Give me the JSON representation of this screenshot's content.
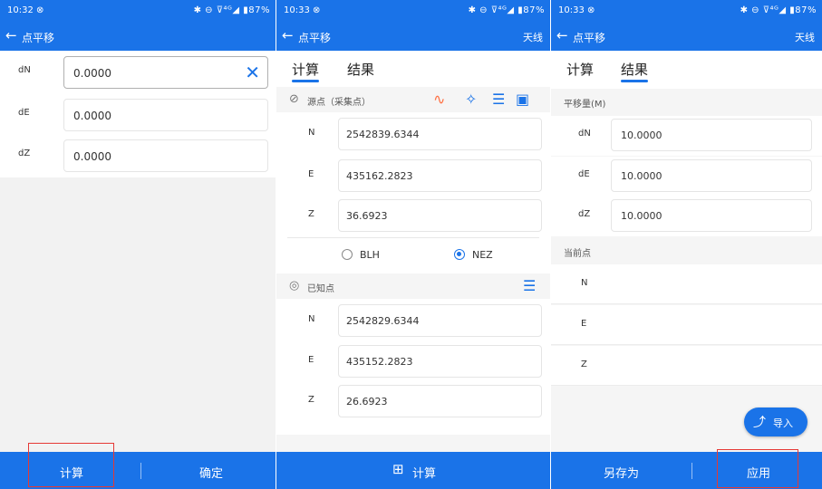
{
  "colors": {
    "primary": "#1a73e8",
    "highlight": "#e53935"
  },
  "panels": [
    {
      "status": {
        "time": "10:32 ⊗",
        "icons": "✱ ⊖ ⊽⁴ᴳ◢ ▮87%"
      },
      "title": "点平移",
      "back_icon": "arrow-left-icon",
      "rows": [
        {
          "label": "dN",
          "value": "0.0000"
        },
        {
          "label": "dE",
          "value": "0.0000"
        },
        {
          "label": "dZ",
          "value": "0.0000"
        }
      ],
      "buttons": {
        "calculate": "计算",
        "confirm": "确定"
      }
    },
    {
      "status": {
        "time": "10:33 ⊗",
        "icons": "✱ ⊖ ⊽⁴ᴳ◢ ▮87%"
      },
      "title": "点平移",
      "action": "天线",
      "tabs": {
        "calc": "计算",
        "result": "结果"
      },
      "source_section": {
        "label": "源点（采集点）"
      },
      "source_rows": [
        {
          "label": "N",
          "value": "2542839.6344"
        },
        {
          "label": "E",
          "value": "435162.2823"
        },
        {
          "label": "Z",
          "value": "36.6923"
        }
      ],
      "coord_modes": {
        "blh": "BLH",
        "nez": "NEZ",
        "selected": "NEZ"
      },
      "known_section": {
        "label": "已知点"
      },
      "known_rows": [
        {
          "label": "N",
          "value": "2542829.6344"
        },
        {
          "label": "E",
          "value": "435152.2823"
        },
        {
          "label": "Z",
          "value": "26.6923"
        }
      ],
      "bottom_button": "计算"
    },
    {
      "status": {
        "time": "10:33 ⊗",
        "icons": "✱ ⊖ ⊽⁴ᴳ◢ ▮87%"
      },
      "title": "点平移",
      "action": "天线",
      "tabs": {
        "calc": "计算",
        "result": "结果"
      },
      "offset_section": "平移量(M)",
      "offset_rows": [
        {
          "label": "dN",
          "value": "10.0000"
        },
        {
          "label": "dE",
          "value": "10.0000"
        },
        {
          "label": "dZ",
          "value": "10.0000"
        }
      ],
      "current_section": "当前点",
      "current_rows": [
        {
          "label": "N"
        },
        {
          "label": "E"
        },
        {
          "label": "Z"
        }
      ],
      "import_label": "导入",
      "buttons": {
        "save_as": "另存为",
        "apply": "应用"
      }
    }
  ]
}
